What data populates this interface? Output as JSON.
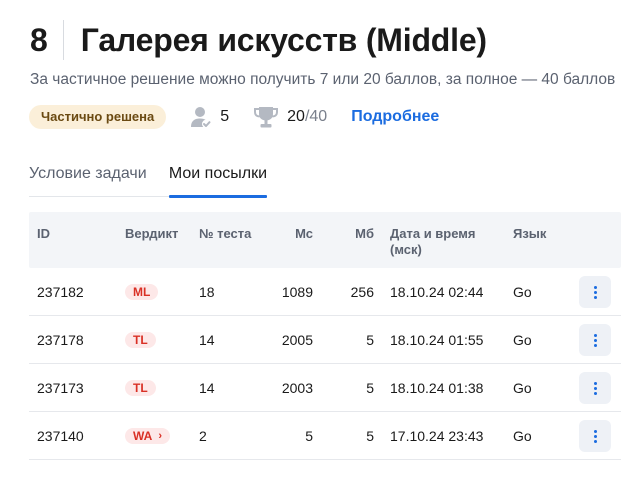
{
  "task": {
    "number": "8",
    "title": "Галерея искусств (Middle)",
    "subtitle": "За частичное решение можно получить 7 или 20 баллов, за полное — 40 баллов"
  },
  "meta": {
    "status": "Частично решена",
    "solvers_icon": "user-check-icon",
    "solvers": "5",
    "score_icon": "trophy-icon",
    "score": "20",
    "score_max": "/40",
    "more": "Подробнее"
  },
  "tabs": [
    {
      "label": "Условие задачи",
      "active": false
    },
    {
      "label": "Мои посылки",
      "active": true
    }
  ],
  "table": {
    "headers": {
      "id": "ID",
      "verdict": "Вердикт",
      "test": "№ теста",
      "ms": "Мс",
      "mb": "Мб",
      "datetime_1": "Дата и время",
      "datetime_2": "(мск)",
      "lang": "Язык"
    },
    "rows": [
      {
        "id": "237182",
        "verdict": "ML",
        "test": "18",
        "ms": "1089",
        "mb": "256",
        "datetime": "18.10.24 02:44",
        "lang": "Go"
      },
      {
        "id": "237178",
        "verdict": "TL",
        "test": "14",
        "ms": "2005",
        "mb": "5",
        "datetime": "18.10.24 01:55",
        "lang": "Go"
      },
      {
        "id": "237173",
        "verdict": "TL",
        "test": "14",
        "ms": "2003",
        "mb": "5",
        "datetime": "18.10.24 01:38",
        "lang": "Go"
      },
      {
        "id": "237140",
        "verdict": "WA",
        "verdict_chevron": "›",
        "test": "2",
        "ms": "5",
        "mb": "5",
        "datetime": "17.10.24 23:43",
        "lang": "Go"
      }
    ]
  },
  "colors": {
    "accent": "#1b6ce0",
    "verdict_text": "#d93025",
    "verdict_bg": "#fde8e8",
    "status_bg": "#fbefd9"
  }
}
